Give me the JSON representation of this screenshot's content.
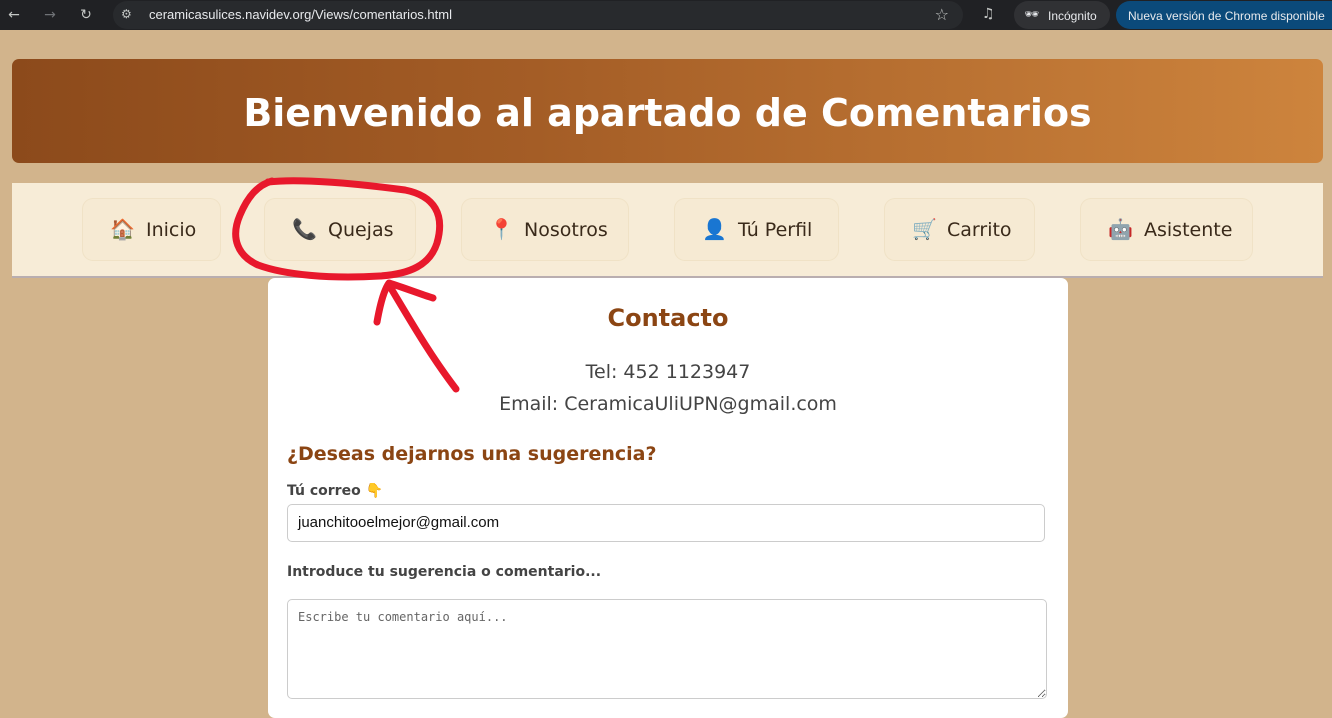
{
  "browser": {
    "url": "ceramicasulices.navidev.org/Views/comentarios.html",
    "incognito_label": "Incógnito",
    "update_label": "Nueva versión de Chrome disponible"
  },
  "header": {
    "title": "Bienvenido al apartado de Comentarios"
  },
  "nav": {
    "items": [
      {
        "icon": "🏠",
        "label": "Inicio"
      },
      {
        "icon": "📞",
        "label": "Quejas"
      },
      {
        "icon": "📍",
        "label": "Nosotros"
      },
      {
        "icon": "👤",
        "label": "Tú Perfil"
      },
      {
        "icon": "🛒",
        "label": "Carrito"
      },
      {
        "icon": "🤖",
        "label": "Asistente"
      }
    ]
  },
  "contact": {
    "title": "Contacto",
    "tel": "Tel: 452 1123947",
    "email": "Email: CeramicaUliUPN@gmail.com"
  },
  "form": {
    "heading": "¿Deseas dejarnos una sugerencia?",
    "email_label": "Tú correo 👇",
    "email_value": "juanchitooelmejor@gmail.com",
    "comment_label": "Introduce tu sugerencia o comentario...",
    "comment_placeholder": "Escribe tu comentario aquí..."
  },
  "colors": {
    "accent": "#8b4513",
    "background": "#d2b48c",
    "annotation": "#e8182c"
  }
}
